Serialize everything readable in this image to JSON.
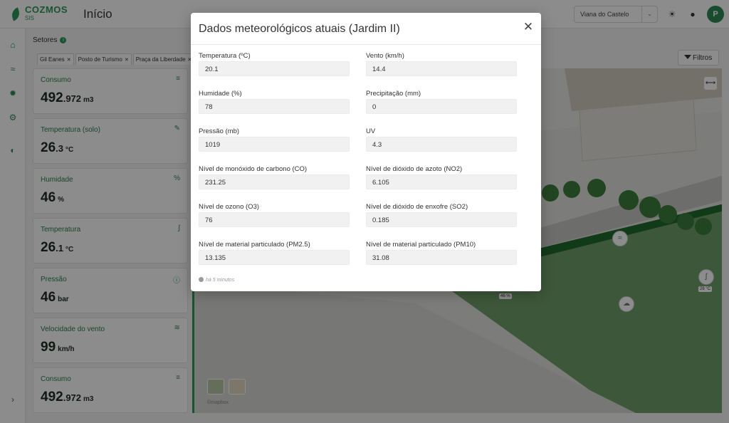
{
  "app": {
    "logo_line1": "COZMOS",
    "logo_line2": "SIS",
    "page_title": "Início",
    "city": "Viana do Castelo",
    "user_initial": "P"
  },
  "sectors": {
    "label": "Setores",
    "chips": [
      "Gil Eanes",
      "Posto de Turismo",
      "Praça da Liberdade"
    ]
  },
  "filters_label": "Filtros",
  "cards": [
    {
      "label": "Consumo",
      "int": "492",
      "dec": ".972",
      "unit": "m3",
      "icon": "list-icon"
    },
    {
      "label": "Temperatura (solo)",
      "int": "26",
      "dec": ".3",
      "unit": "°C",
      "icon": "pen-icon"
    },
    {
      "label": "Humidade",
      "int": "46",
      "dec": "",
      "unit": "%",
      "icon": "percent-icon"
    },
    {
      "label": "Temperatura",
      "int": "26",
      "dec": ".1",
      "unit": "°C",
      "icon": "thermometer-icon"
    },
    {
      "label": "Pressão",
      "int": "46",
      "dec": "",
      "unit": "bar",
      "icon": "info-icon"
    },
    {
      "label": "Velocidade do vento",
      "int": "99",
      "dec": "",
      "unit": "km/h",
      "icon": "wind-icon"
    },
    {
      "label": "Consumo",
      "int": "492",
      "dec": ".972",
      "unit": "m3",
      "icon": "list-icon"
    }
  ],
  "map": {
    "tag_humidity": "46 %",
    "tag_temp": "26 °C",
    "attribution": "©mapbox"
  },
  "modal": {
    "title": "Dados meteorológicos atuais (Jardim II)",
    "close": "✕",
    "fields": [
      {
        "label": "Temperatura (ºC)",
        "value": "20.1"
      },
      {
        "label": "Vento (km/h)",
        "value": "14.4"
      },
      {
        "label": "Humidade (%)",
        "value": "78"
      },
      {
        "label": "Precipitação (mm)",
        "value": "0"
      },
      {
        "label": "Pressão (mb)",
        "value": "1019"
      },
      {
        "label": "UV",
        "value": "4.3"
      },
      {
        "label": "Nível de monóxido de carbono (CO)",
        "value": "231.25"
      },
      {
        "label": "Nível de dióxido de azoto (NO2)",
        "value": "6.105"
      },
      {
        "label": "Nível de ozono (O3)",
        "value": "76"
      },
      {
        "label": "Nível de dióxido de enxofre (SO2)",
        "value": "0.185"
      },
      {
        "label": "Nível de material particulado (PM2.5)",
        "value": "13.135"
      },
      {
        "label": "Nível de material particulado (PM10)",
        "value": "31.08"
      }
    ],
    "updated": "há 5 minutos"
  }
}
